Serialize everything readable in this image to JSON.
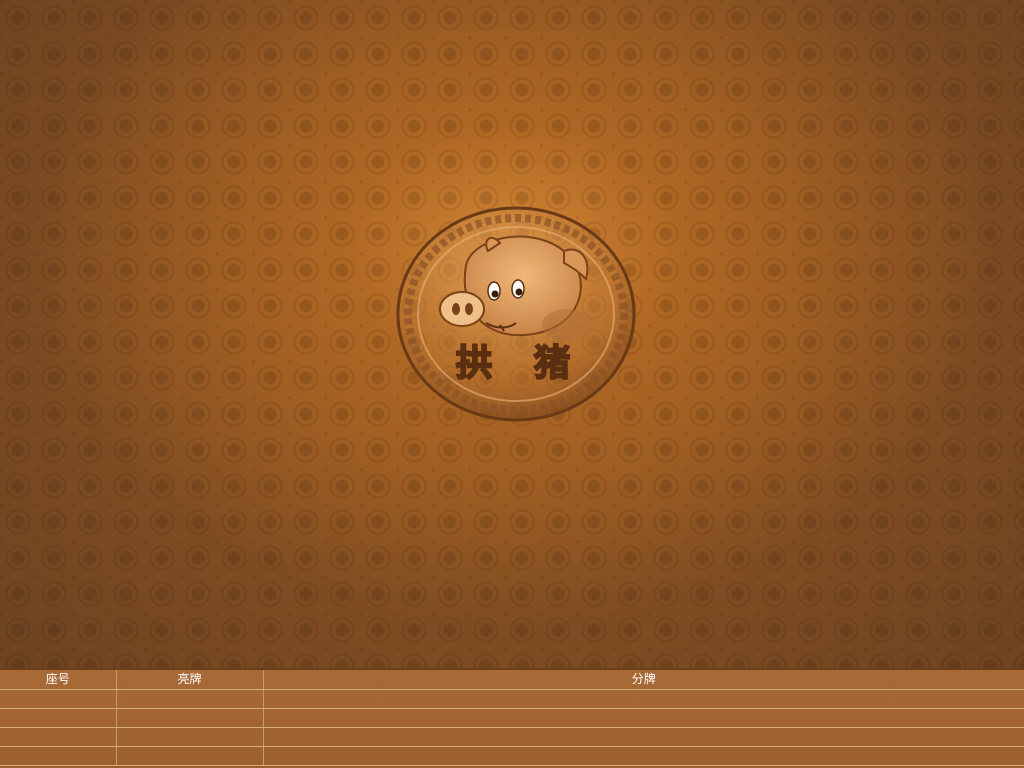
{
  "logo": {
    "title_chars": [
      "拱",
      "猪"
    ],
    "icon": "pig-face-icon"
  },
  "colors": {
    "background_center": "#d68a36",
    "background_edge": "#5e3a1e",
    "table_bg": "#a86a36",
    "table_lines": "#d7ad7c",
    "header_text": "#ffffff"
  },
  "table": {
    "headers": [
      "座号",
      "亮牌",
      "分牌"
    ],
    "rows": [
      [
        "",
        "",
        ""
      ],
      [
        "",
        "",
        ""
      ],
      [
        "",
        "",
        ""
      ],
      [
        "",
        "",
        ""
      ]
    ]
  }
}
